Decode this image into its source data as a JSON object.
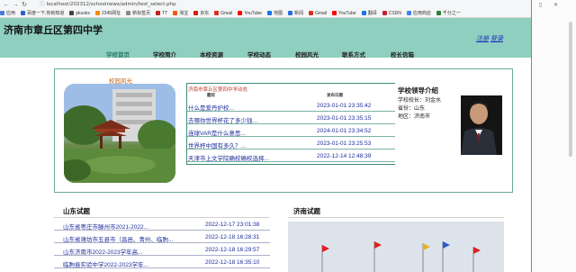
{
  "browser": {
    "address": "localhost/202312/schoolnews/admin/test_select.php",
    "bookmarks": [
      {
        "label": "应用",
        "color": "#4a7bd8"
      },
      {
        "label": "百度一下,你就知道",
        "color": "#2e5fc9"
      },
      {
        "label": "pkuxkx",
        "color": "#444444"
      },
      {
        "label": "2345网址",
        "color": "#ff8a00"
      },
      {
        "label": "新标签页",
        "color": "#8a8a8a"
      },
      {
        "label": "TT",
        "color": "#c02020"
      },
      {
        "label": "淘宝",
        "color": "#ff5000"
      },
      {
        "label": "京东",
        "color": "#d81e06"
      },
      {
        "label": "Gmail",
        "color": "#d93025"
      },
      {
        "label": "YouTube",
        "color": "#ff0000"
      },
      {
        "label": "地图",
        "color": "#1a73e8"
      },
      {
        "label": "新闻",
        "color": "#2a6cd8"
      },
      {
        "label": "Gmail",
        "color": "#d93025"
      },
      {
        "label": "YouTube",
        "color": "#ff0000"
      },
      {
        "label": "翻译",
        "color": "#1a73e8"
      },
      {
        "label": "CSDN",
        "color": "#c32136"
      },
      {
        "label": "应用商店",
        "color": "#3b82f6"
      },
      {
        "label": "千分之一",
        "color": "#2e7d32"
      }
    ]
  },
  "header": {
    "site_title": "济南市章丘区第四中学",
    "register_label": "注册",
    "login_label": "登录",
    "bg_color": "#8fcfbf"
  },
  "nav": {
    "items": [
      {
        "label": "学校首页",
        "active": true
      },
      {
        "label": "学校简介",
        "active": false
      },
      {
        "label": "本校资源",
        "active": false
      },
      {
        "label": "学校动态",
        "active": false
      },
      {
        "label": "校园风光",
        "active": false
      },
      {
        "label": "联系方式",
        "active": false
      },
      {
        "label": "校长信箱",
        "active": false
      }
    ]
  },
  "campus": {
    "caption": "校园风光"
  },
  "news": {
    "title": "济南市章丘区第四中学动态",
    "col_title": "题目",
    "col_date": "发布日期",
    "rows": [
      {
        "title": "什么是爱丹护校...",
        "date": "2023-01-01 23:35:42"
      },
      {
        "title": "去哪你世界杯花了多少钱...",
        "date": "2023-01-01 23:35:15"
      },
      {
        "title": "连球VAR是什么意思...",
        "date": "2024-01-01 23:34:52"
      },
      {
        "title": "世界杯中国有多久？...",
        "date": "2023-01-01 23:25:53"
      },
      {
        "title": "天津市上文学院确校确校选择...",
        "date": "2022-12-14 12:48:39"
      }
    ]
  },
  "leader": {
    "title": "学校领导介绍",
    "lines": [
      "学校校长：刘金水",
      "省份：山东",
      "地区：济南市"
    ]
  },
  "shandong": {
    "title": "山东试题",
    "rows": [
      {
        "title": "山东省枣庄市滕州市2021-2022...",
        "date": "2022-12-17 23:01:38"
      },
      {
        "title": "山东省潍坊市五县市（昌邑、青州、临朐...",
        "date": "2022-12-18 16:28:31"
      },
      {
        "title": "山东济南市2022-2023学年高...",
        "date": "2022-12-18 16:29:57"
      },
      {
        "title": "临朐县实验中学2022-2023学年...",
        "date": "2022-12-18 16:35:10"
      }
    ]
  },
  "jinan": {
    "title": "济南试题"
  }
}
